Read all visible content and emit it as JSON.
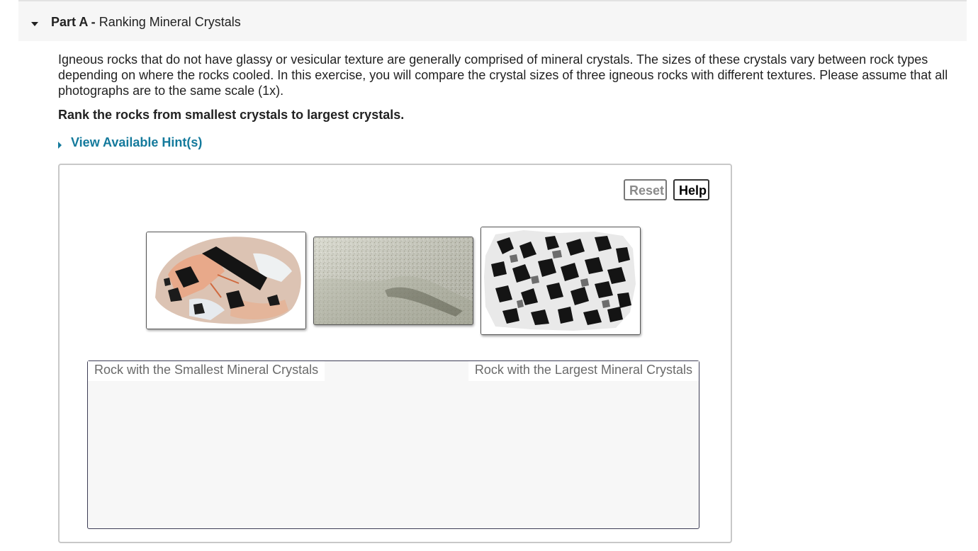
{
  "part": {
    "label": "Part A -",
    "title": "Ranking Mineral Crystals"
  },
  "intro": "Igneous rocks that do not have glassy or vesicular texture are generally comprised of mineral crystals. The sizes of these crystals vary between rock types depending on where the rocks cooled. In this exercise, you will compare the crystal sizes of three igneous rocks with different textures. Please assume that all photographs are to the same scale (1x).",
  "instruction": "Rank the rocks from smallest crystals to largest crystals.",
  "hints": {
    "label": "View Available Hint(s)"
  },
  "toolbar": {
    "reset_label": "Reset",
    "help_label": "Help"
  },
  "rocks": [
    {
      "description": "pegmatite with large black crystals",
      "colors": [
        "#e8b89a",
        "#111111",
        "#d8dde0"
      ]
    },
    {
      "description": "fine-grained gray rock",
      "colors": [
        "#c9caba",
        "#8a8a7a"
      ]
    },
    {
      "description": "speckled black and white coarse rock",
      "colors": [
        "#f2f2f2",
        "#141414"
      ]
    }
  ],
  "ranking": {
    "left_label": "Rock with the Smallest Mineral Crystals",
    "right_label": "Rock with the Largest Mineral Crystals"
  },
  "colors": {
    "accent": "#147a9c",
    "header_bg": "#f6f6f6",
    "zone_bg": "#f7f7f7"
  }
}
